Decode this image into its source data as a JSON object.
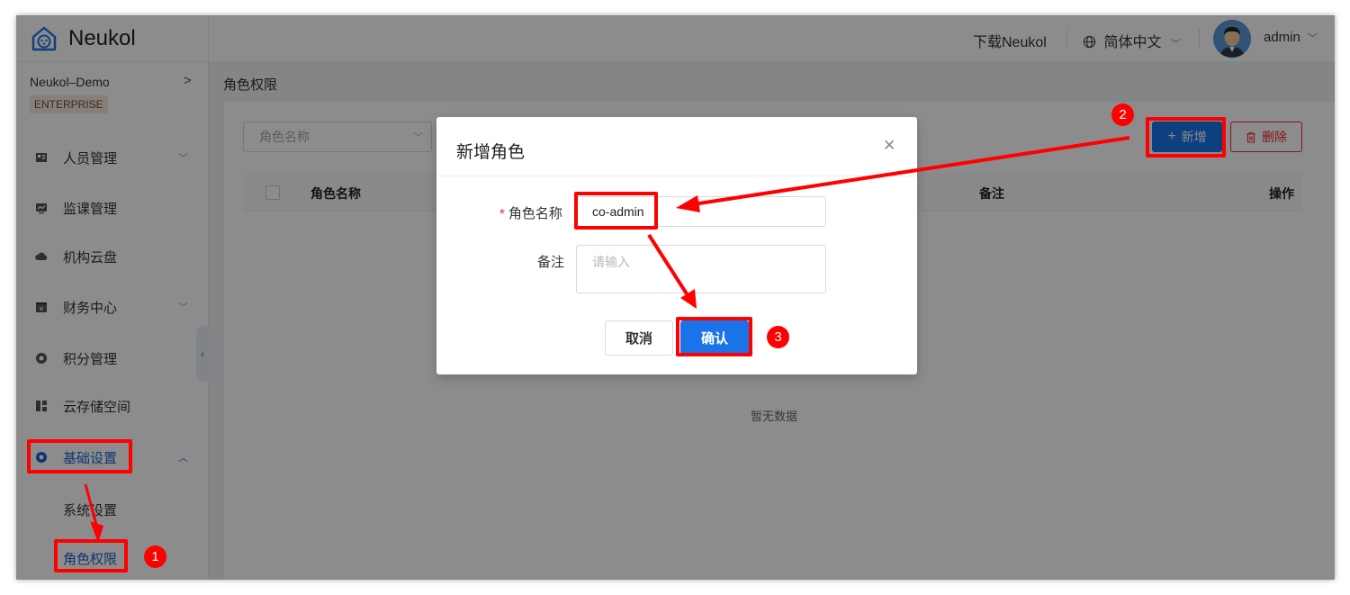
{
  "app": {
    "logo_text": "Neukol",
    "org_name": "Neukol–Demo",
    "org_arrow": ">",
    "edition": "ENTERPRISE"
  },
  "menu": [
    {
      "label": "人员管理",
      "icon": "people-icon"
    },
    {
      "label": "监课管理",
      "icon": "monitor-icon"
    },
    {
      "label": "机构云盘",
      "icon": "cloud-icon"
    },
    {
      "label": "财务中心",
      "icon": "finance-icon"
    },
    {
      "label": "积分管理",
      "icon": "points-icon"
    },
    {
      "label": "云存储空间",
      "icon": "storage-icon"
    },
    {
      "label": "基础设置",
      "icon": "settings-icon"
    }
  ],
  "submenu": {
    "system": "系统设置",
    "roles": "角色权限"
  },
  "topbar": {
    "download": "下载Neukol",
    "language": "简体中文",
    "user": "admin"
  },
  "breadcrumb": "角色权限",
  "filter": {
    "placeholder": "角色名称"
  },
  "toolbar": {
    "add": "新增",
    "delete": "删除"
  },
  "table": {
    "columns": {
      "name": "角色名称",
      "note": "备注",
      "action": "操作"
    },
    "empty": "暂无数据"
  },
  "modal": {
    "title": "新增角色",
    "name_label": "角色名称",
    "name_value": "co-admin",
    "note_label": "备注",
    "note_placeholder": "请输入",
    "cancel": "取消",
    "confirm": "确认"
  },
  "steps": [
    "1",
    "2",
    "3"
  ],
  "colors": {
    "primary": "#1a73e8",
    "danger": "#f5222d",
    "annotation": "#ff0000"
  }
}
